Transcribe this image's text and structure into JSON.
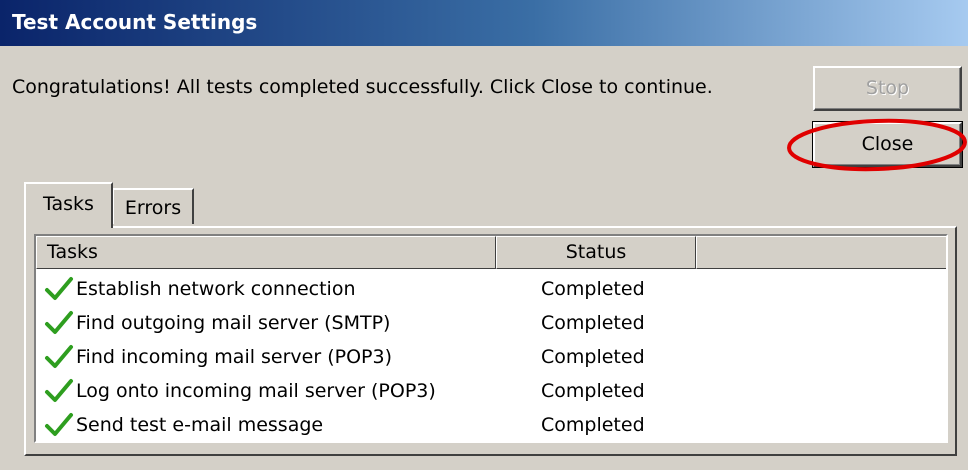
{
  "window": {
    "title": "Test Account Settings"
  },
  "message": "Congratulations! All tests completed successfully. Click Close to continue.",
  "buttons": {
    "stop_label": "Stop",
    "close_label": "Close"
  },
  "tabs": [
    {
      "label": "Tasks",
      "selected": true
    },
    {
      "label": "Errors",
      "selected": false
    }
  ],
  "table": {
    "columns": [
      "Tasks",
      "Status"
    ],
    "rows": [
      {
        "task": "Establish network connection",
        "status": "Completed",
        "icon": "checkmark-icon"
      },
      {
        "task": "Find outgoing mail server (SMTP)",
        "status": "Completed",
        "icon": "checkmark-icon"
      },
      {
        "task": "Find incoming mail server (POP3)",
        "status": "Completed",
        "icon": "checkmark-icon"
      },
      {
        "task": "Log onto incoming mail server (POP3)",
        "status": "Completed",
        "icon": "checkmark-icon"
      },
      {
        "task": "Send test e-mail message",
        "status": "Completed",
        "icon": "checkmark-icon"
      }
    ]
  },
  "colors": {
    "titlebar_start": "#0a246a",
    "dialog_bg": "#d4d0c8",
    "checkmark": "#2e9e1f",
    "highlight_ring": "#e00000"
  }
}
